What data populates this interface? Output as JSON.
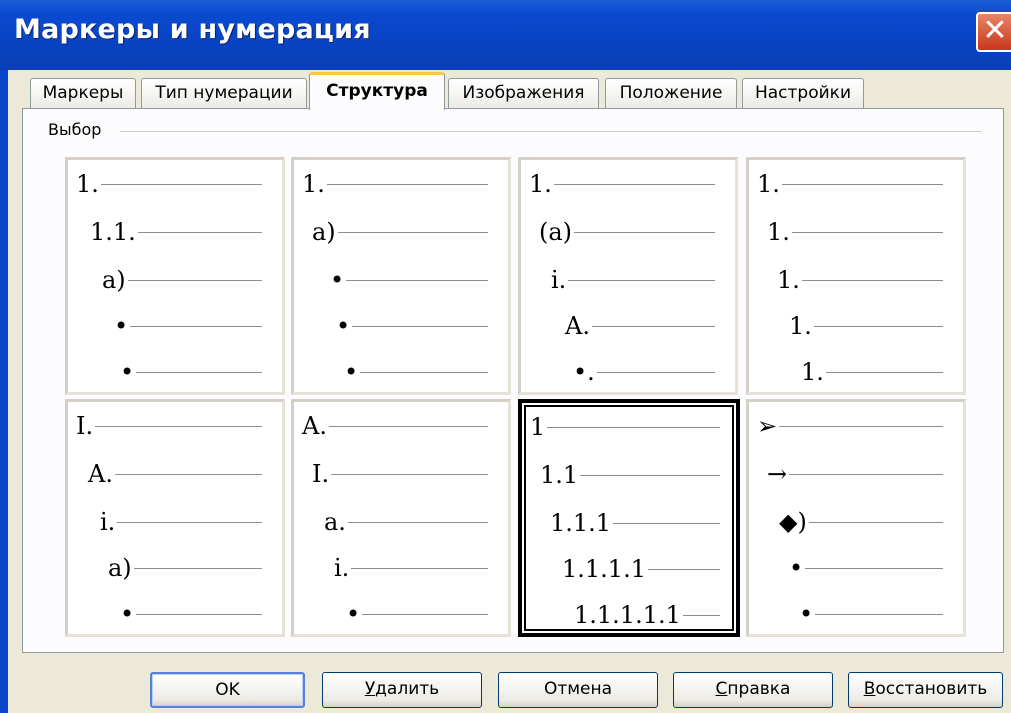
{
  "window": {
    "title": "Маркеры и нумерация",
    "close_label": "✕"
  },
  "tabs": [
    {
      "label": "Маркеры"
    },
    {
      "label": "Тип нумерации"
    },
    {
      "label": "Структура",
      "active": true
    },
    {
      "label": "Изображения"
    },
    {
      "label": "Положение"
    },
    {
      "label": "Настройки"
    }
  ],
  "group": {
    "label": "Выбор"
  },
  "presets": [
    {
      "lines": [
        "1.",
        "1.1.",
        "a)",
        "•",
        "•"
      ]
    },
    {
      "lines": [
        "1.",
        "a)",
        "•",
        "•",
        "•"
      ]
    },
    {
      "lines": [
        "1.",
        "(a)",
        "i.",
        "A.",
        "•."
      ]
    },
    {
      "lines": [
        "1.",
        "1.",
        "1.",
        "1.",
        "1."
      ]
    },
    {
      "lines": [
        "I.",
        "A.",
        "i.",
        "a)",
        "•"
      ]
    },
    {
      "lines": [
        "A.",
        "I.",
        "a.",
        "i.",
        "•"
      ]
    },
    {
      "lines": [
        "1",
        "1.1",
        "1.1.1",
        "1.1.1.1",
        "1.1.1.1.1"
      ],
      "selected": true
    },
    {
      "lines": [
        "➢",
        "→",
        "◆)",
        "•",
        "•"
      ]
    }
  ],
  "buttons": {
    "ok": "OK",
    "delete": {
      "first": "У",
      "rest": "далить"
    },
    "cancel": "Отмена",
    "help": {
      "first": "С",
      "rest": "правка"
    },
    "restore": {
      "first": "В",
      "rest": "осстановить"
    }
  }
}
